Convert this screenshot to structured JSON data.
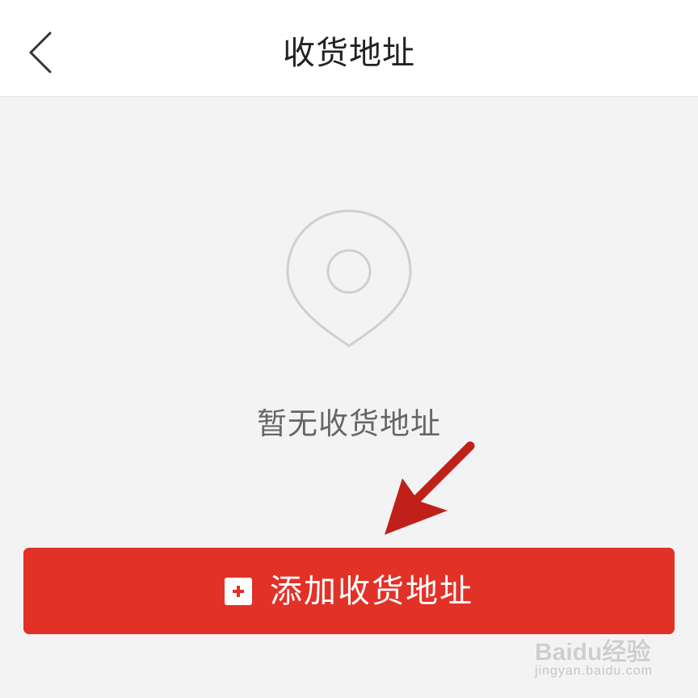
{
  "header": {
    "back_icon": "chevron-left-icon",
    "title": "收货地址"
  },
  "empty_state": {
    "icon": "location-pin-icon",
    "message": "暂无收货地址"
  },
  "add_button": {
    "icon": "plus-square-icon",
    "label": "添加收货地址",
    "color": "#e23127"
  },
  "annotation": {
    "arrow_color": "#c0201a"
  },
  "watermark": {
    "brand": "Baidu经验",
    "url": "jingyan.baidu.com"
  },
  "colors": {
    "background": "#f3f3f3",
    "header": "#ffffff",
    "accent": "#e23127"
  }
}
